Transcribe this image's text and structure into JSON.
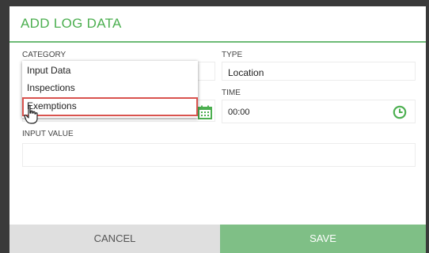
{
  "dialog": {
    "title": "ADD LOG DATA",
    "accent_color": "#4caf50"
  },
  "fields": {
    "category_label": "CATEGORY",
    "type_label": "TYPE",
    "type_value": "Location",
    "time_label": "TIME",
    "time_value": "00:00",
    "input_value_label": "INPUT VALUE",
    "input_value": ""
  },
  "category_dropdown": {
    "options": [
      "Input Data",
      "Inspections",
      "Exemptions"
    ],
    "highlighted": "Exemptions"
  },
  "buttons": {
    "cancel": "CANCEL",
    "save": "SAVE"
  },
  "icons": {
    "date": "calendar-icon",
    "time": "clock-icon",
    "cursor": "hand-pointer-icon"
  }
}
